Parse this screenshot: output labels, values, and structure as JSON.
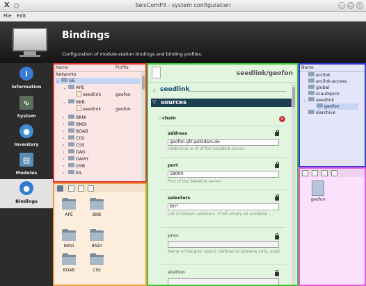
{
  "window": {
    "title": "SeisComP3 - system configuration",
    "close_glyph": "X",
    "buttons": [
      "−",
      "□",
      "×"
    ]
  },
  "menu": {
    "items": [
      "File",
      "Edit"
    ]
  },
  "header": {
    "title": "Bindings",
    "subtitle": "Configuration of module-station bindings and binding profiles."
  },
  "sidebar": {
    "items": [
      {
        "label": "Information",
        "icon": "info-icon",
        "glyph": "i",
        "color": "#3a7bd5"
      },
      {
        "label": "System",
        "icon": "system-monitor-icon",
        "glyph": "∿",
        "color": "#5a6e5a"
      },
      {
        "label": "Inventory",
        "icon": "globe-icon",
        "glyph": "●",
        "color": "#3f8fd6"
      },
      {
        "label": "Modules",
        "icon": "modules-folder-icon",
        "glyph": "▤",
        "color": "#5d8bb8"
      },
      {
        "label": "Bindings",
        "icon": "bindings-globe-icon",
        "glyph": "●",
        "color": "#2f7bd1"
      }
    ]
  },
  "stations_tree": {
    "headers": {
      "name": "Name",
      "profile": "Profile"
    },
    "rows": [
      {
        "label": "Networks",
        "profile": ""
      },
      {
        "label": "GE",
        "profile": ""
      },
      {
        "label": "APE",
        "profile": ""
      },
      {
        "label": "seedlink",
        "profile": "geofon"
      },
      {
        "label": "BKB",
        "profile": ""
      },
      {
        "label": "seedlink",
        "profile": "geofon"
      },
      {
        "label": "BKNI",
        "profile": ""
      },
      {
        "label": "BNDI",
        "profile": ""
      },
      {
        "label": "BOAB",
        "profile": ""
      },
      {
        "label": "CISI",
        "profile": ""
      },
      {
        "label": "CSS",
        "profile": ""
      },
      {
        "label": "DAG",
        "profile": ""
      },
      {
        "label": "DAMY",
        "profile": ""
      },
      {
        "label": "DSB",
        "profile": ""
      },
      {
        "label": "EIL",
        "profile": ""
      }
    ]
  },
  "station_tiles": [
    "APE",
    "BKB",
    "BKNI",
    "BNDI",
    "BOAB",
    "CISI"
  ],
  "editor": {
    "path": "seedlink/geofon",
    "section": "seedlink",
    "group": "sources",
    "subgroup": "chain",
    "delete_glyph": "×",
    "fields": [
      {
        "label": "address",
        "value": "geofon.gfz-potsdam.de",
        "hint": "Hostname or IP of the Seedlink server.",
        "locked": false
      },
      {
        "label": "port",
        "value": "18000",
        "hint": "Port of the Seedlink server",
        "locked": false
      },
      {
        "label": "selectors",
        "value": "BH?",
        "hint": "List of stream selectors. If left empty all available ...",
        "locked": false
      },
      {
        "label": "proc",
        "value": "",
        "hint": "Name of the proc object (defined in streams.xml); used ...",
        "locked": true
      },
      {
        "label": "station",
        "value": "",
        "hint": "",
        "locked": true
      }
    ]
  },
  "modules_tree": {
    "header": "Name",
    "rows": [
      {
        "label": "arclink",
        "depth": 1
      },
      {
        "label": "arclink-access",
        "depth": 1
      },
      {
        "label": "global",
        "depth": 1
      },
      {
        "label": "scautopick",
        "depth": 1
      },
      {
        "label": "seedlink",
        "depth": 1
      },
      {
        "label": "geofon",
        "depth": 2
      },
      {
        "label": "slarchive",
        "depth": 1
      }
    ]
  },
  "profile_tiles": [
    "geofon"
  ]
}
